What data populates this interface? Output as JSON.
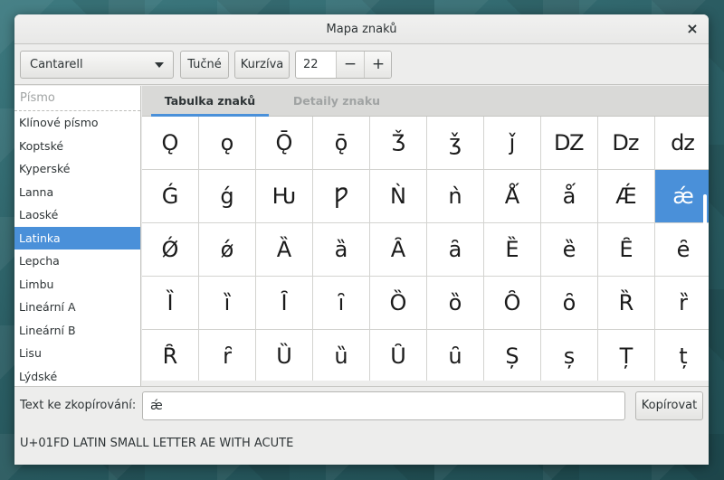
{
  "window": {
    "title": "Mapa znaků",
    "close_glyph": "×"
  },
  "toolbar": {
    "font_combo_value": "Cantarell",
    "bold_label": "Tučné",
    "italic_label": "Kurzíva",
    "size_value": "22",
    "minus_glyph": "−",
    "plus_glyph": "+"
  },
  "sidebar": {
    "header_placeholder": "Písmo",
    "items": [
      {
        "label": "Klínové písmo",
        "selected": false
      },
      {
        "label": "Koptské",
        "selected": false
      },
      {
        "label": "Kyperské",
        "selected": false
      },
      {
        "label": "Lanna",
        "selected": false
      },
      {
        "label": "Laoské",
        "selected": false
      },
      {
        "label": "Latinka",
        "selected": true
      },
      {
        "label": "Lepcha",
        "selected": false
      },
      {
        "label": "Limbu",
        "selected": false
      },
      {
        "label": "Lineární A",
        "selected": false
      },
      {
        "label": "Lineární B",
        "selected": false
      },
      {
        "label": "Lisu",
        "selected": false
      },
      {
        "label": "Lýdské",
        "selected": false
      }
    ]
  },
  "tabs": [
    {
      "label": "Tabulka znaků",
      "active": true
    },
    {
      "label": "Detaily znaku",
      "active": false
    }
  ],
  "char_grid": {
    "rows": [
      [
        "Ǫ",
        "ǫ",
        "Ǭ",
        "ǭ",
        "Ǯ",
        "ǯ",
        "ǰ",
        "Ǳ",
        "ǲ",
        "ǳ"
      ],
      [
        "Ǵ",
        "ǵ",
        "Ƕ",
        "Ƿ",
        "Ǹ",
        "ǹ",
        "Ǻ",
        "ǻ",
        "Ǽ",
        "ǽ"
      ],
      [
        "Ǿ",
        "ǿ",
        "Ȁ",
        "ȁ",
        "Ȃ",
        "ȃ",
        "Ȅ",
        "ȅ",
        "Ȇ",
        "ȇ"
      ],
      [
        "Ȉ",
        "ȉ",
        "Ȋ",
        "ȋ",
        "Ȍ",
        "ȍ",
        "Ȏ",
        "ȏ",
        "Ȑ",
        "ȑ"
      ],
      [
        "Ȓ",
        "ȓ",
        "Ȕ",
        "ȕ",
        "Ȗ",
        "ȗ",
        "Ș",
        "ș",
        "Ț",
        "ț"
      ]
    ],
    "selected": {
      "row": 1,
      "col": 9
    }
  },
  "copy": {
    "label": "Text ke zkopírování:",
    "value": "ǽ",
    "button_label": "Kopírovat"
  },
  "status": {
    "text": "U+01FD LATIN SMALL LETTER AE WITH ACUTE"
  },
  "colors": {
    "accent": "#4a90d9",
    "window_bg": "#ededec"
  }
}
